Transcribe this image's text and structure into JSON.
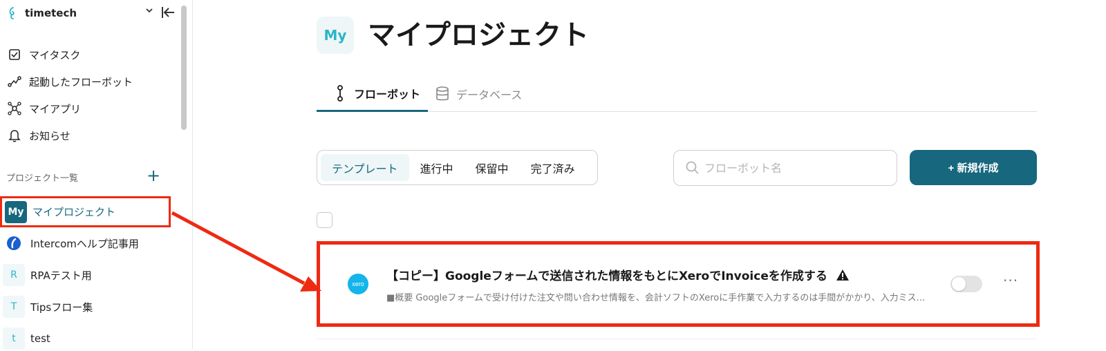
{
  "sidebar": {
    "workspace_name": "timetech",
    "nav": [
      {
        "label": "マイタスク",
        "icon": "checkbox-icon"
      },
      {
        "label": "起動したフローボット",
        "icon": "flow-icon"
      },
      {
        "label": "マイアプリ",
        "icon": "apps-hub-icon"
      },
      {
        "label": "お知らせ",
        "icon": "bell-icon"
      }
    ],
    "projects_header": "プロジェクト一覧",
    "projects": [
      {
        "badge": "My",
        "label": "マイプロジェクト"
      },
      {
        "badge": "",
        "label": "Intercomヘルプ記事用"
      },
      {
        "badge": "R",
        "label": "RPAテスト用"
      },
      {
        "badge": "T",
        "label": "Tipsフロー集"
      },
      {
        "badge": "t",
        "label": "test"
      }
    ]
  },
  "main": {
    "page_icon": "My",
    "page_title": "マイプロジェクト",
    "tabs": [
      {
        "label": "フローボット",
        "icon": "flowbot-icon"
      },
      {
        "label": "データベース",
        "icon": "database-icon"
      }
    ],
    "filters": [
      "テンプレート",
      "進行中",
      "保留中",
      "完了済み"
    ],
    "search_placeholder": "フローボット名",
    "new_button": "+ 新規作成",
    "flows": [
      {
        "app_icon_text": "xero",
        "title": "【コピー】Googleフォームで送信された情報をもとにXeroでInvoiceを作成する",
        "description": "■概要 Googleフォームで受け付けた注文や問い合わせ情報を、会計ソフトのXeroに手作業で入力するのは手間がかかり、入力ミス...",
        "enabled": false
      }
    ]
  },
  "colors": {
    "accent": "#17677e",
    "teal": "#2bb5c9",
    "highlight": "#ee2a12",
    "xero": "#13b5ea"
  }
}
